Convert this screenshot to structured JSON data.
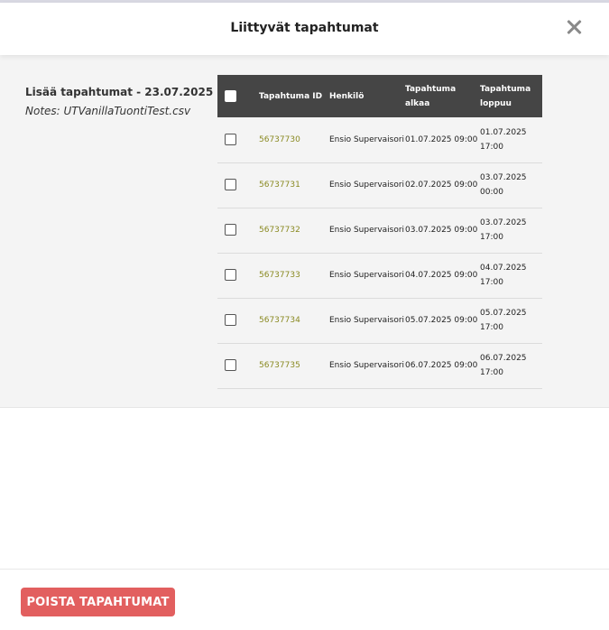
{
  "dialog": {
    "title": "Liittyvät tapahtumat",
    "close_icon": "close-icon"
  },
  "import": {
    "title": "Lisää tapahtumat - 23.07.2025",
    "notes": "Notes: UTVanillaTuontiTest.csv"
  },
  "table": {
    "headers": {
      "id": "Tapahtuma ID",
      "person": "Henkilö",
      "start": "Tapahtuma alkaa",
      "end": "Tapahtuma loppuu"
    },
    "rows": [
      {
        "id": "56737730",
        "person": "Ensio Supervaisori",
        "start": "01.07.2025 09:00",
        "end": "01.07.2025 17:00"
      },
      {
        "id": "56737731",
        "person": "Ensio Supervaisori",
        "start": "02.07.2025 09:00",
        "end": "03.07.2025 00:00"
      },
      {
        "id": "56737732",
        "person": "Ensio Supervaisori",
        "start": "03.07.2025 09:00",
        "end": "03.07.2025 17:00"
      },
      {
        "id": "56737733",
        "person": "Ensio Supervaisori",
        "start": "04.07.2025 09:00",
        "end": "04.07.2025 17:00"
      },
      {
        "id": "56737734",
        "person": "Ensio Supervaisori",
        "start": "05.07.2025 09:00",
        "end": "05.07.2025 17:00"
      },
      {
        "id": "56737735",
        "person": "Ensio Supervaisori",
        "start": "06.07.2025 09:00",
        "end": "06.07.2025 17:00"
      }
    ]
  },
  "footer": {
    "delete_label": "POISTA TAPAHTUMAT"
  },
  "colors": {
    "header_bg": "#454545",
    "link": "#8a8a22",
    "danger": "#e25f5f",
    "panel_bg": "#f4f4f4"
  }
}
